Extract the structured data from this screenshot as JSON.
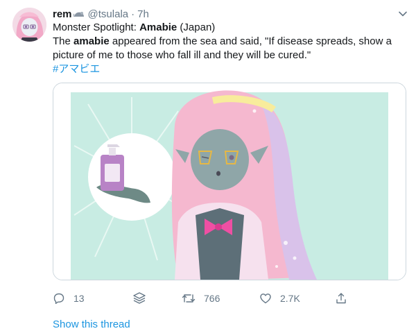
{
  "tweet": {
    "display_name": "rem",
    "handle": "@tsulala",
    "separator": "·",
    "time": "7h",
    "line1_prefix": "Monster Spotlight: ",
    "line1_bold": "Amabie",
    "line1_suffix": " (Japan)",
    "line2_prefix": "The ",
    "line2_bold": "amabie",
    "line2_suffix": " appeared from the sea and said, \"If disease spreads, show a",
    "line3": "picture of me to those who fall ill and they will be cured.\"",
    "hashtag": "#アマビエ"
  },
  "actions": {
    "reply_count": "13",
    "retweet_count": "766",
    "like_count": "2.7K"
  },
  "show_thread": "Show this thread",
  "colors": {
    "link": "#1b95e0",
    "secondary_text": "#657786",
    "mint_background": "#c8ece3",
    "hair_pink": "#f5b8cf"
  },
  "icons": {
    "caret": "chevron-down-icon",
    "reply": "reply-icon",
    "stack": "stack-icon",
    "retweet": "retweet-icon",
    "like": "heart-icon",
    "share": "share-icon"
  }
}
